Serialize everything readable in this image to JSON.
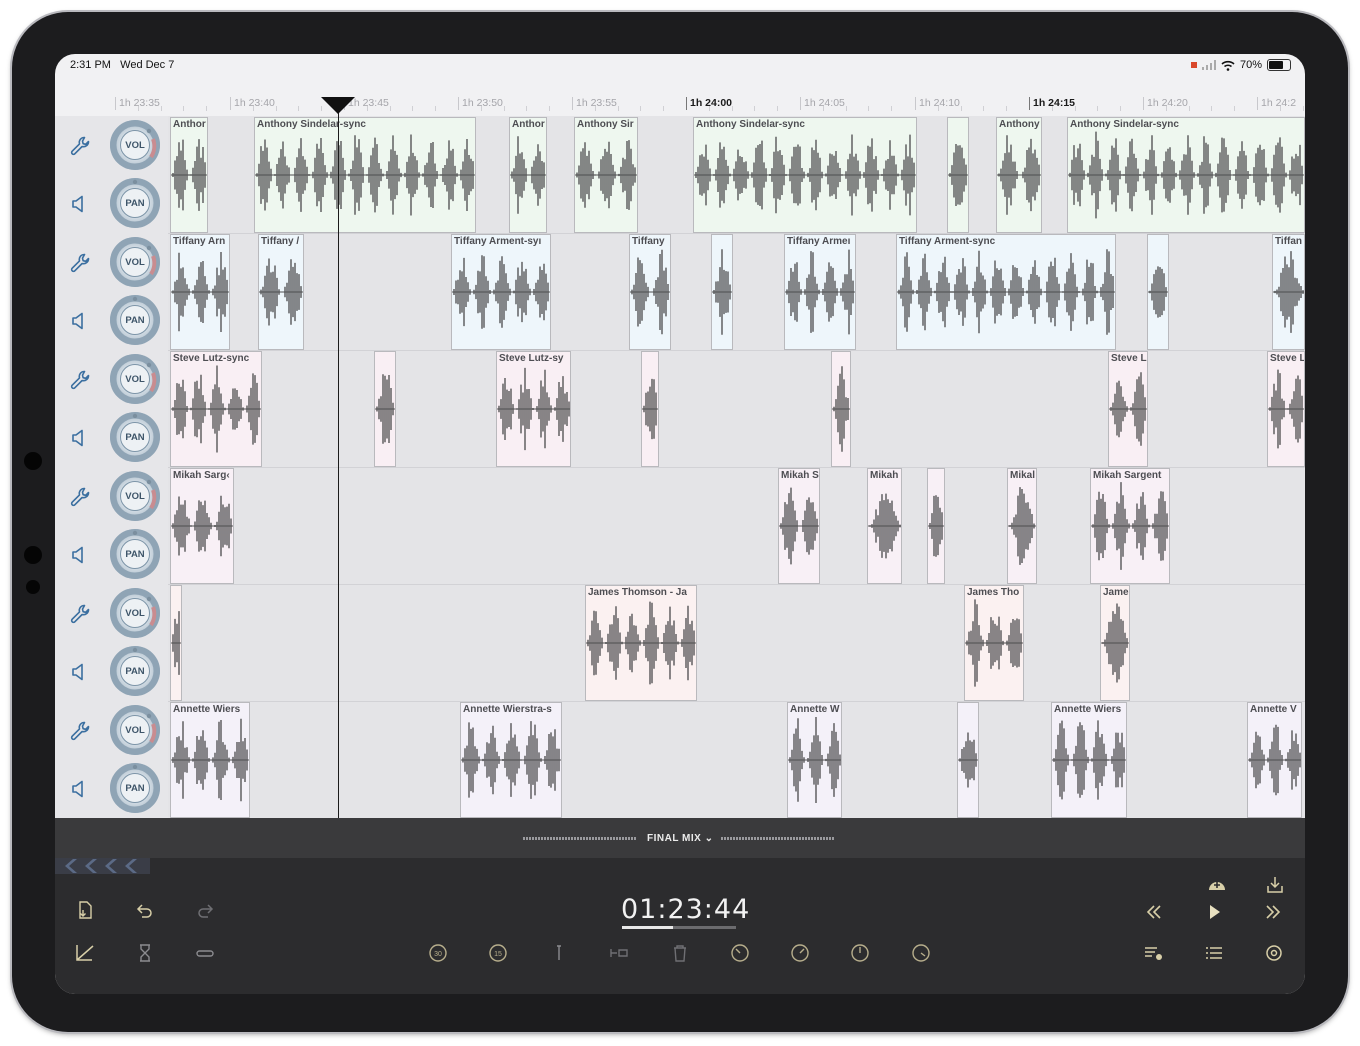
{
  "status_bar": {
    "time": "2:31 PM",
    "date": "Wed Dec 7",
    "battery": "70%"
  },
  "ruler": {
    "ticks": [
      {
        "label": "1h 23:35",
        "major": false
      },
      {
        "label": "1h 23:40",
        "major": false
      },
      {
        "label": "1h 23:45",
        "major": false
      },
      {
        "label": "1h 23:50",
        "major": false
      },
      {
        "label": "1h 23:55",
        "major": false
      },
      {
        "label": "1h 24:00",
        "major": true
      },
      {
        "label": "1h 24:05",
        "major": false
      },
      {
        "label": "1h 24:10",
        "major": false
      },
      {
        "label": "1h 24:15",
        "major": true
      },
      {
        "label": "1h 24:20",
        "major": false
      },
      {
        "label": "1h 24:2",
        "major": false
      }
    ]
  },
  "track_controls": {
    "vol_label": "VOL",
    "pan_label": "PAN"
  },
  "tracks": [
    {
      "color": "#eef7ef",
      "clips": [
        {
          "label": "Anthor"
        },
        {
          "label": "Anthony Sindelar-sync"
        },
        {
          "label": "Anthor"
        },
        {
          "label": "Anthony Sir"
        },
        {
          "label": "Anthony Sindelar-sync"
        },
        {
          "label": ""
        },
        {
          "label": "Anthony"
        },
        {
          "label": "Anthony Sindelar-sync"
        }
      ]
    },
    {
      "color": "#eef6fb",
      "clips": [
        {
          "label": "Tiffany Arn"
        },
        {
          "label": "Tiffany /"
        },
        {
          "label": "Tiffany Arment-syı"
        },
        {
          "label": "Tiffany"
        },
        {
          "label": ""
        },
        {
          "label": "Tiffany Armeı"
        },
        {
          "label": "Tiffany Arment-sync"
        },
        {
          "label": ""
        },
        {
          "label": "Tiffan"
        }
      ]
    },
    {
      "color": "#f9eff4",
      "clips": [
        {
          "label": "Steve Lutz-sync"
        },
        {
          "label": ""
        },
        {
          "label": "Steve Lutz-sy"
        },
        {
          "label": ""
        },
        {
          "label": ""
        },
        {
          "label": "Steve L"
        },
        {
          "label": "Steve L"
        }
      ]
    },
    {
      "color": "#f8f0f6",
      "clips": [
        {
          "label": "Mikah Sarg‹"
        },
        {
          "label": "Mikah S"
        },
        {
          "label": "Mikah"
        },
        {
          "label": ""
        },
        {
          "label": "Mikal"
        },
        {
          "label": "Mikah Sargent"
        }
      ]
    },
    {
      "color": "#fbf1f1",
      "clips": [
        {
          "label": ""
        },
        {
          "label": "James Thomson - Ja"
        },
        {
          "label": "James Tho"
        },
        {
          "label": "Jame"
        }
      ]
    },
    {
      "color": "#f4f1f9",
      "clips": [
        {
          "label": "Annette Wiers"
        },
        {
          "label": "Annette Wierstra-s"
        },
        {
          "label": "Annette W"
        },
        {
          "label": ""
        },
        {
          "label": "Annette Wiers"
        },
        {
          "label": "Annette V"
        }
      ]
    }
  ],
  "mix": {
    "label": "FINAL MIX"
  },
  "transport": {
    "timecode": "01:23:44",
    "progress": 0.45
  },
  "toolbar": {
    "top_left": [
      "import-icon",
      "undo-icon",
      "redo-icon"
    ],
    "bottom_left": [
      "trim-icon",
      "hourglass-icon",
      "link-icon"
    ],
    "center": [
      "skip-back-30-icon",
      "skip-back-15-icon",
      "split-icon",
      "fade-icon",
      "trash-icon",
      "gauge-1-icon",
      "gauge-2-icon",
      "gauge-3-icon",
      "gauge-4-icon"
    ],
    "right": [
      "add-chapter-icon",
      "list-icon",
      "settings-icon",
      "rewind-icon",
      "play-icon",
      "fast-forward-icon",
      "add-icon",
      "export-icon"
    ]
  }
}
